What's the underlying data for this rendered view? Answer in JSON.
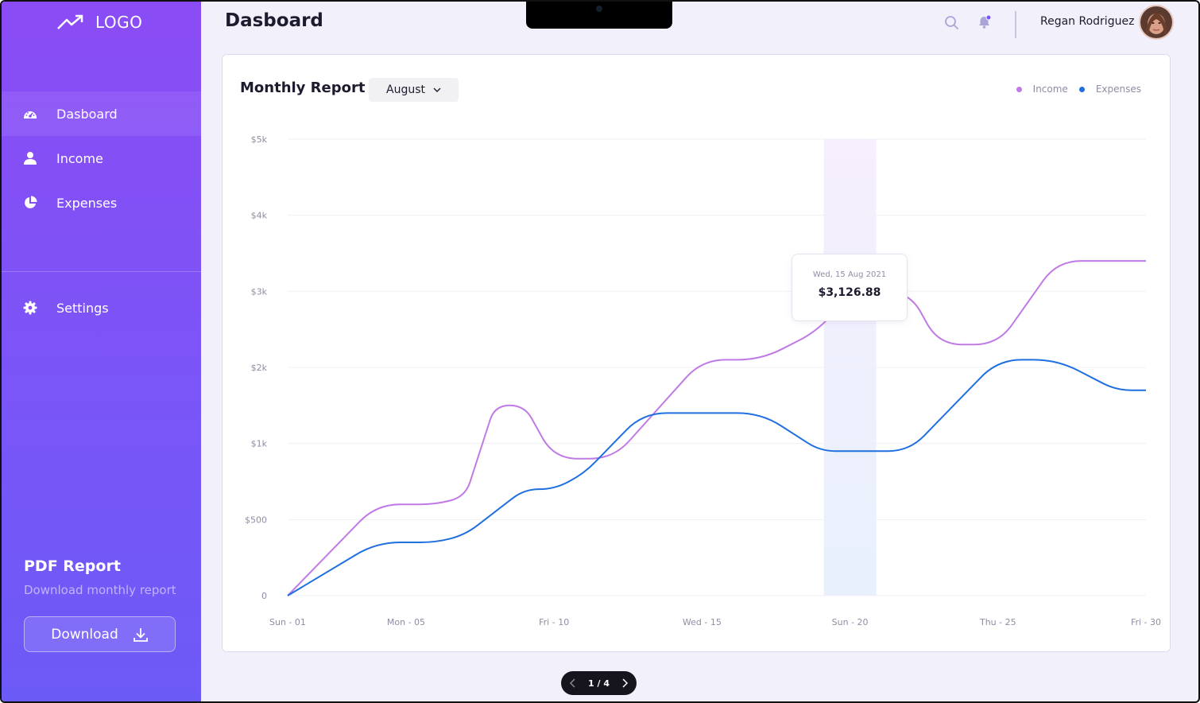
{
  "sidebar": {
    "logo_text": "LOGO",
    "nav": [
      {
        "label": "Dasboard",
        "icon": "dashboard-gauge-icon",
        "active": true
      },
      {
        "label": "Income",
        "icon": "user-icon",
        "active": false
      },
      {
        "label": "Expenses",
        "icon": "pie-chart-icon",
        "active": false
      }
    ],
    "settings_label": "Settings",
    "pdf_title": "PDF Report",
    "pdf_subtitle": "Download monthly report",
    "download_label": "Download"
  },
  "header": {
    "title": "Dasboard",
    "user_name": "Regan Rodriguez"
  },
  "report": {
    "title": "Monthly Report",
    "month": "August",
    "tooltip_date": "Wed, 15 Aug 2021",
    "tooltip_value": "$3,126.88"
  },
  "pager": {
    "text": "1 / 4"
  },
  "colors": {
    "income": "#c07ae6",
    "expenses": "#1f6fe0",
    "accent": "#7b55f7"
  },
  "chart_data": {
    "type": "line",
    "title": "",
    "xlabel": "",
    "ylabel": "",
    "x_ticks": [
      "Sun - 01",
      "Mon - 05",
      "Fri - 10",
      "Wed - 15",
      "Sun - 20",
      "Thu - 25",
      "Fri - 30"
    ],
    "y_ticks": [
      "0",
      "$500",
      "$1k",
      "$2k",
      "$3k",
      "$4k",
      "$5k"
    ],
    "legend": [
      "Income",
      "Expenses"
    ],
    "legend_position": "top-right",
    "grid": true,
    "highlight_tick": "Sun - 20",
    "highlight_point": {
      "series": "Income",
      "label": "Sun - 20",
      "value": "$3,126.88"
    },
    "series": [
      {
        "name": "Income",
        "x": [
          1,
          4,
          6,
          7,
          8,
          9,
          10,
          12,
          15,
          17,
          19,
          20,
          22,
          23,
          25,
          27,
          29,
          30
        ],
        "values": [
          0,
          1.2,
          1.2,
          1.3,
          2.5,
          2.5,
          1.8,
          1.8,
          3.1,
          3.1,
          3.5,
          4.0,
          4.0,
          3.3,
          3.3,
          4.4,
          4.4,
          4.4
        ]
      },
      {
        "name": "Expenses",
        "x": [
          1,
          4,
          6,
          7,
          9,
          10,
          11,
          13,
          17,
          19,
          20,
          22,
          23,
          25,
          27,
          29,
          30
        ],
        "values": [
          0,
          0.7,
          0.7,
          0.8,
          1.4,
          1.4,
          1.6,
          2.4,
          2.4,
          1.9,
          1.9,
          1.9,
          2.3,
          3.1,
          3.1,
          2.7,
          2.7
        ]
      }
    ]
  }
}
